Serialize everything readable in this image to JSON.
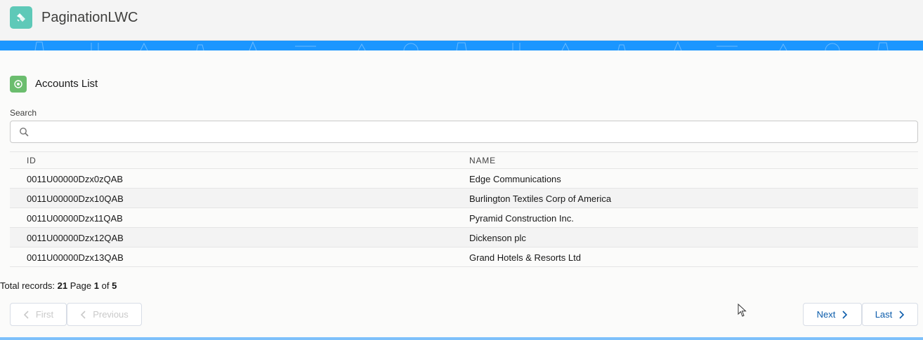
{
  "app": {
    "title": "PaginationLWC"
  },
  "card": {
    "title": "Accounts List"
  },
  "search": {
    "label": "Search",
    "value": "",
    "placeholder": ""
  },
  "table": {
    "columns": [
      "ID",
      "NAME"
    ],
    "rows": [
      {
        "id": "0011U00000Dzx0zQAB",
        "name": "Edge Communications"
      },
      {
        "id": "0011U00000Dzx10QAB",
        "name": "Burlington Textiles Corp of America"
      },
      {
        "id": "0011U00000Dzx11QAB",
        "name": "Pyramid Construction Inc."
      },
      {
        "id": "0011U00000Dzx12QAB",
        "name": "Dickenson plc"
      },
      {
        "id": "0011U00000Dzx13QAB",
        "name": "Grand Hotels & Resorts Ltd"
      }
    ]
  },
  "summary": {
    "total_label": "Total records:",
    "total": "21",
    "page_label": "Page",
    "page": "1",
    "of_label": "of",
    "pages": "5"
  },
  "pagination": {
    "first": "First",
    "previous": "Previous",
    "next": "Next",
    "last": "Last"
  },
  "icons": {
    "app": "app-launcher-icon",
    "card": "account-icon",
    "search": "search-icon",
    "chevron_left": "chevron-left-icon",
    "chevron_right": "chevron-right-icon",
    "cursor": "mouse-cursor-icon"
  },
  "colors": {
    "banner": "#1b96ff",
    "app_icon": "#5ec9b8",
    "card_icon": "#6bbd6e",
    "active_button_text": "#0b5cab",
    "disabled_button_text": "#c9c9c9"
  }
}
